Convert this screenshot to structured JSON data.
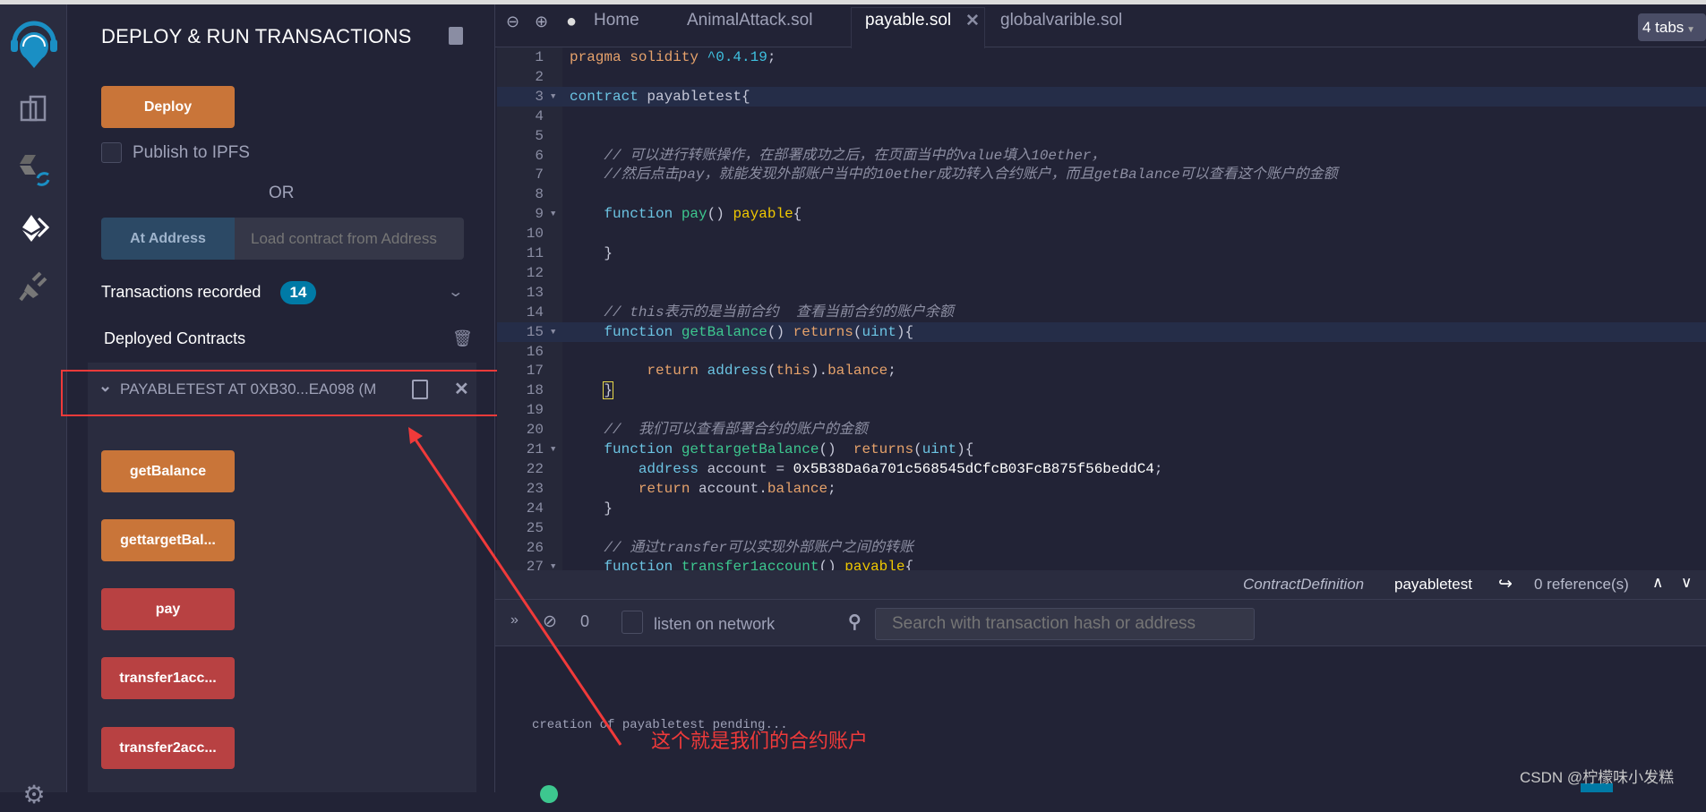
{
  "colors": {
    "deploy": "#c97539",
    "call": "#c97539",
    "transact": "#b84142",
    "accent": "#007aa6",
    "annotation": "#f03a3a"
  },
  "sidebar": {
    "icons": [
      "remix-logo-icon",
      "file-explorer-icon",
      "solidity-compiler-icon",
      "deploy-run-icon",
      "plugin-manager-icon",
      "settings-icon"
    ]
  },
  "panel": {
    "title": "DEPLOY & RUN TRANSACTIONS",
    "deploy_label": "Deploy",
    "publish_label": "Publish to IPFS",
    "or_label": "OR",
    "at_address_label": "At Address",
    "at_address_placeholder": "Load contract from Address",
    "transactions_label": "Transactions recorded",
    "transactions_count": "14",
    "deployed_label": "Deployed Contracts",
    "contract_name": "PAYABLETEST AT 0XB30...EA098 (M",
    "functions": [
      {
        "label": "getBalance",
        "kind": "call"
      },
      {
        "label": "gettargetBal...",
        "kind": "call"
      },
      {
        "label": "pay",
        "kind": "transact"
      },
      {
        "label": "transfer1acc...",
        "kind": "transact"
      },
      {
        "label": "transfer2acc...",
        "kind": "transact"
      }
    ]
  },
  "tabs": {
    "home": "Home",
    "items": [
      "AnimalAttack.sol",
      "payable.sol",
      "globalvarible.sol"
    ],
    "active": "payable.sol",
    "count_label": "4 tabs"
  },
  "editor": {
    "lines": [
      [
        [
          "pragma solidity ",
          "kw"
        ],
        [
          "^0.4.19",
          "ver"
        ],
        [
          ";",
          "tx"
        ]
      ],
      [],
      [
        [
          "contract ",
          "ct"
        ],
        [
          "payabletest{",
          "tx"
        ]
      ],
      [],
      [],
      [
        [
          "    // 可以进行转账操作，在部署成功之后，在页面当中的value填入10ether，",
          "cm"
        ]
      ],
      [
        [
          "    //然后点击pay，就能发现外部账户当中的10ether成功转入合约账户，而且getBalance可以查看这个账户的金额",
          "cm"
        ]
      ],
      [],
      [
        [
          "    function ",
          "ct"
        ],
        [
          "pay",
          "fn"
        ],
        [
          "() ",
          "tx"
        ],
        [
          "payable",
          "py"
        ],
        [
          "{",
          "tx"
        ]
      ],
      [],
      [
        [
          "    }",
          "tx"
        ]
      ],
      [],
      [],
      [
        [
          "    // this表示的是当前合约  查看当前合约的账户余额",
          "cm"
        ]
      ],
      [
        [
          "    function ",
          "ct"
        ],
        [
          "getBalance",
          "fn"
        ],
        [
          "() ",
          "tx"
        ],
        [
          "returns",
          "kw"
        ],
        [
          "(",
          "tx"
        ],
        [
          "uint",
          "ct"
        ],
        [
          "){",
          "tx"
        ]
      ],
      [],
      [
        [
          "         return ",
          "kw"
        ],
        [
          "address",
          "ct"
        ],
        [
          "(",
          "tx"
        ],
        [
          "this",
          "kw"
        ],
        [
          ").",
          "tx"
        ],
        [
          "balance",
          "kw"
        ],
        [
          ";",
          "tx"
        ]
      ],
      [
        [
          "    ",
          "tx"
        ],
        [
          "}",
          "tx"
        ]
      ],
      [],
      [
        [
          "    //  我们可以查看部署合约的账户的金额",
          "cm"
        ]
      ],
      [
        [
          "    function ",
          "ct"
        ],
        [
          "gettargetBalance",
          "fn"
        ],
        [
          "()  ",
          "tx"
        ],
        [
          "returns",
          "kw"
        ],
        [
          "(",
          "tx"
        ],
        [
          "uint",
          "ct"
        ],
        [
          "){",
          "tx"
        ]
      ],
      [
        [
          "        address ",
          "ct"
        ],
        [
          "account = ",
          "tx"
        ],
        [
          "0x5B38Da6a701c568545dCfcB03FcB875f56beddC4",
          "num"
        ],
        [
          ";",
          "tx"
        ]
      ],
      [
        [
          "        return ",
          "kw"
        ],
        [
          "account.",
          "tx"
        ],
        [
          "balance",
          "kw"
        ],
        [
          ";",
          "tx"
        ]
      ],
      [
        [
          "    }",
          "tx"
        ]
      ],
      [],
      [
        [
          "    // 通过transfer可以实现外部账户之间的转账",
          "cm"
        ]
      ],
      [
        [
          "    function ",
          "ct"
        ],
        [
          "transfer1account",
          "fn"
        ],
        [
          "() ",
          "tx"
        ],
        [
          "payable",
          "py"
        ],
        [
          "{",
          "tx"
        ]
      ]
    ],
    "fold_lines": [
      3,
      9,
      15,
      21,
      27
    ],
    "highlight_lines": [
      3,
      15
    ]
  },
  "status": {
    "definition_kind": "ContractDefinition",
    "definition_name": "payabletest",
    "references": "0 reference(s)"
  },
  "terminal": {
    "pending_count": "0",
    "listen_label": "listen on network",
    "search_placeholder": "Search with transaction hash or address",
    "log": "creation of payabletest pending..."
  },
  "annotation": {
    "text": "这个就是我们的合约账户"
  },
  "watermark": "CSDN @柠檬味小发糕"
}
